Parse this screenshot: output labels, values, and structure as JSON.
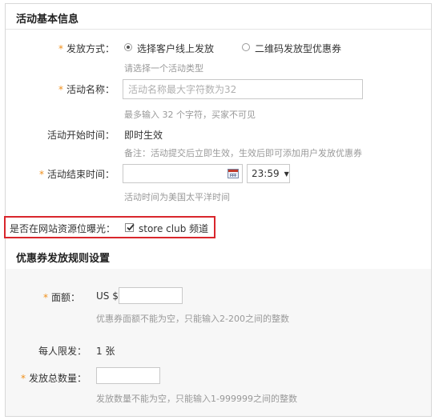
{
  "basic_info": {
    "title": "活动基本信息",
    "issue_method": {
      "label": "发放方式：",
      "options": [
        "选择客户线上发放",
        "二维码发放型优惠券"
      ],
      "selected": "选择客户线上发放",
      "hint": "请选择一个活动类型"
    },
    "activity_name": {
      "label": "活动名称：",
      "placeholder": "活动名称最大字符数为32",
      "value": "",
      "hint": "最多输入 32 个字符，买家不可见"
    },
    "start_time": {
      "label": "活动开始时间：",
      "value": "即时生效",
      "hint": "备注：活动提交后立即生效，生效后即可添加用户发放优惠券"
    },
    "end_time": {
      "label": "活动结束时间：",
      "date_value": "",
      "time_value": "23:59",
      "hint": "活动时间为美国太平洋时间"
    },
    "exposure": {
      "label": "是否在网站资源位曝光：",
      "checked": true,
      "option_label": "store club 频道",
      "highlight_color": "#d9262c"
    }
  },
  "rules": {
    "title": "优惠券发放规则设置",
    "denomination": {
      "label": "面额：",
      "prefix": "US $",
      "value": "",
      "hint": "优惠券面额不能为空，只能输入2-200之间的整数"
    },
    "per_person_limit": {
      "label": "每人限发：",
      "value": "1 张"
    },
    "total_quantity": {
      "label": "发放总数量：",
      "value": "",
      "hint": "发放数量不能为空，只能输入1-999999之间的整数"
    }
  },
  "colors": {
    "required_star": "#f0901c",
    "hint_text": "#999999"
  },
  "icons": {
    "required": "*",
    "calendar": "calendar-icon",
    "dropdown": "▼",
    "check": "checkmark-icon"
  }
}
